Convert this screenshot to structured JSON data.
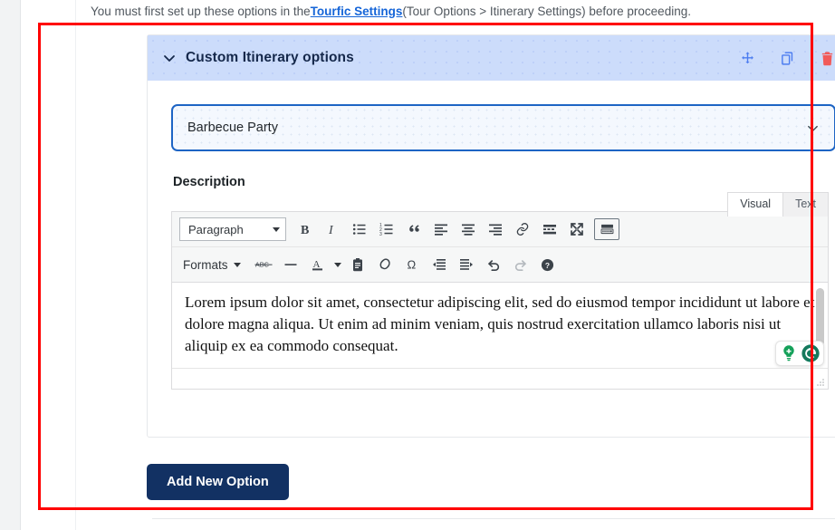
{
  "notice": {
    "text_before": "You must first set up these options in the ",
    "link_label": "Tourfic Settings",
    "text_after": " (Tour Options > Itinerary Settings) before proceeding."
  },
  "panel": {
    "title": "Custom Itinerary options",
    "collapse_icon": "chevron-down-icon",
    "actions": [
      {
        "name": "move-handle",
        "icon": "move-arrows-icon",
        "color": "#4c7df0"
      },
      {
        "name": "duplicate",
        "icon": "copy-icon",
        "color": "#4c7df0"
      },
      {
        "name": "delete",
        "icon": "trash-icon",
        "color": "#f15a5a"
      }
    ],
    "header_bg": "#ccdcfb",
    "title_color": "#15284b"
  },
  "itinerary_select": {
    "value": "Barbecue Party",
    "caret_icon": "chevron-down-icon",
    "border_color": "#1d64c4"
  },
  "description": {
    "label": "Description",
    "tabs": [
      {
        "label": "Visual",
        "active": true
      },
      {
        "label": "Text",
        "active": false
      }
    ],
    "toolbar_row1": [
      {
        "name": "paragraph-format-select",
        "label": "Paragraph",
        "type": "select"
      },
      {
        "name": "bold-button",
        "icon": "bold-icon",
        "glyph": "B"
      },
      {
        "name": "italic-button",
        "icon": "italic-icon",
        "glyph": "I"
      },
      {
        "name": "bulleted-list-button",
        "icon": "bullet-list-icon"
      },
      {
        "name": "numbered-list-button",
        "icon": "numbered-list-icon"
      },
      {
        "name": "blockquote-button",
        "icon": "quote-icon"
      },
      {
        "name": "align-left-button",
        "icon": "align-left-icon"
      },
      {
        "name": "align-center-button",
        "icon": "align-center-icon"
      },
      {
        "name": "align-right-button",
        "icon": "align-right-icon"
      },
      {
        "name": "insert-link-button",
        "icon": "link-icon"
      },
      {
        "name": "read-more-button",
        "icon": "read-more-icon"
      },
      {
        "name": "fullscreen-button",
        "icon": "fullscreen-icon"
      },
      {
        "name": "toolbar-toggle-button",
        "icon": "kitchen-sink-icon"
      }
    ],
    "toolbar_row2": [
      {
        "name": "formats-menu",
        "label": "Formats",
        "type": "menu"
      },
      {
        "name": "strikethrough-button",
        "icon": "strikethrough-icon",
        "glyph": "ABC"
      },
      {
        "name": "horizontal-rule-button",
        "icon": "horizontal-rule-icon"
      },
      {
        "name": "text-color-button",
        "icon": "text-color-icon",
        "glyph": "A"
      },
      {
        "name": "paste-as-text-button",
        "icon": "paste-text-icon"
      },
      {
        "name": "clear-formatting-button",
        "icon": "eraser-icon"
      },
      {
        "name": "special-character-button",
        "icon": "omega-icon",
        "glyph": "Ω"
      },
      {
        "name": "outdent-button",
        "icon": "outdent-icon"
      },
      {
        "name": "indent-button",
        "icon": "indent-icon"
      },
      {
        "name": "undo-button",
        "icon": "undo-icon"
      },
      {
        "name": "redo-button",
        "icon": "redo-icon",
        "disabled": true
      },
      {
        "name": "keyboard-help-button",
        "icon": "help-icon"
      }
    ],
    "body_text": "Lorem ipsum dolor sit amet, consectetur adipiscing elit, sed do eiusmod tempor incididunt ut labore et dolore magna aliqua. Ut enim ad minim veniam, quis nostrud exercitation ullamco laboris nisi ut aliquip ex ea commodo consequat.",
    "assistant": [
      {
        "name": "grammarly-suggestion-bulb",
        "icon": "lightbulb-icon"
      },
      {
        "name": "grammarly-logo",
        "icon": "grammarly-g-icon"
      }
    ]
  },
  "add_button": {
    "label": "Add New Option",
    "bg": "#123163"
  },
  "highlight": {
    "color": "#ff0000"
  }
}
